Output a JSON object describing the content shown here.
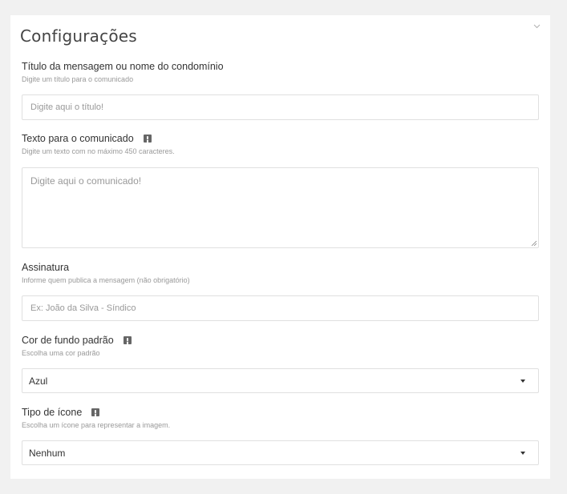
{
  "panel": {
    "title": "Configurações",
    "collapse_icon": "chevron-down-icon"
  },
  "fields": {
    "titulo": {
      "label": "Título da mensagem ou nome do condomínio",
      "help": "Digite um título para o comunicado",
      "placeholder": "Digite aqui o título!"
    },
    "texto": {
      "label": "Texto para o comunicado",
      "info_icon": "info-icon",
      "help": "Digite um texto com no máximo 450 caracteres.",
      "placeholder": "Digite aqui o comunicado!"
    },
    "assinatura": {
      "label": "Assinatura",
      "help": "Informe quem publica a mensagem (não obrigatório)",
      "placeholder": "Ex: João da Silva - Síndico"
    },
    "cor": {
      "label": "Cor de fundo padrão",
      "info_icon": "info-icon",
      "help": "Escolha uma cor padrão",
      "selected": "Azul"
    },
    "icone": {
      "label": "Tipo de ícone",
      "info_icon": "info-icon",
      "help": "Escolha um ícone para representar a imagem.",
      "selected": "Nenhum"
    }
  }
}
